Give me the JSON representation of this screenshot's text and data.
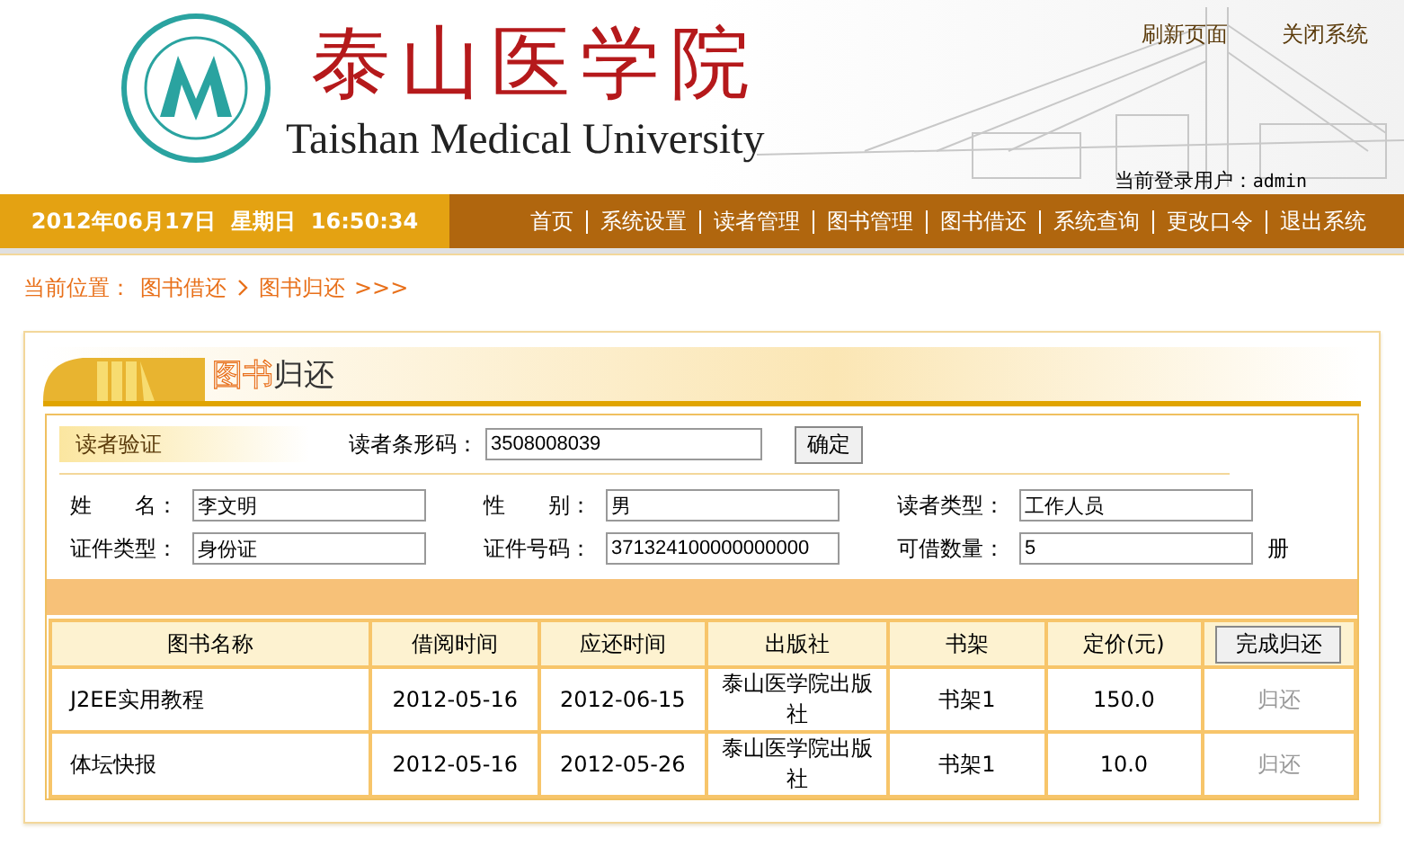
{
  "header": {
    "title_cn": "泰山医学院",
    "title_en": "Taishan Medical University",
    "links": [
      "刷新页面",
      "关闭系统"
    ],
    "user_label": "当前登录用户：",
    "user_name": "admin"
  },
  "nav": {
    "datetime": "2012年06月17日  星期日  16:50:34",
    "items": [
      "首页",
      "系统设置",
      "读者管理",
      "图书管理",
      "图书借还",
      "系统查询",
      "更改口令",
      "退出系统"
    ]
  },
  "breadcrumb": {
    "label": "当前位置：",
    "items": [
      "图书借还",
      "图书归还"
    ],
    "trail": ">>>"
  },
  "panel": {
    "title_parts": [
      {
        "text": "图书",
        "highlight": true
      },
      {
        "text": "归还",
        "highlight": false
      }
    ],
    "verify_label": "读者验证",
    "barcode_label": "读者条形码：",
    "barcode_value": "3508008039",
    "confirm_button": "确定",
    "fields": [
      {
        "label": "姓　　名：",
        "value": "李文明"
      },
      {
        "label": "性　　别：",
        "value": "男"
      },
      {
        "label": "读者类型：",
        "value": "工作人员"
      },
      {
        "label": "证件类型：",
        "value": "身份证"
      },
      {
        "label": "证件号码：",
        "value": "371324100000000000"
      },
      {
        "label": "可借数量：",
        "value": "5",
        "unit": "册"
      }
    ],
    "table": {
      "columns": [
        "图书名称",
        "借阅时间",
        "应还时间",
        "出版社",
        "书架",
        "定价(元)"
      ],
      "finish_button": "完成归还",
      "rows": [
        {
          "cells": [
            "J2EE实用教程",
            "2012-05-16",
            "2012-06-15",
            "泰山医学院出版社",
            "书架1",
            "150.0"
          ],
          "action": "归还",
          "disabled": true
        },
        {
          "cells": [
            "体坛快报",
            "2012-05-16",
            "2012-05-26",
            "泰山医学院出版社",
            "书架1",
            "10.0"
          ],
          "action": "归还",
          "disabled": true
        }
      ]
    }
  }
}
